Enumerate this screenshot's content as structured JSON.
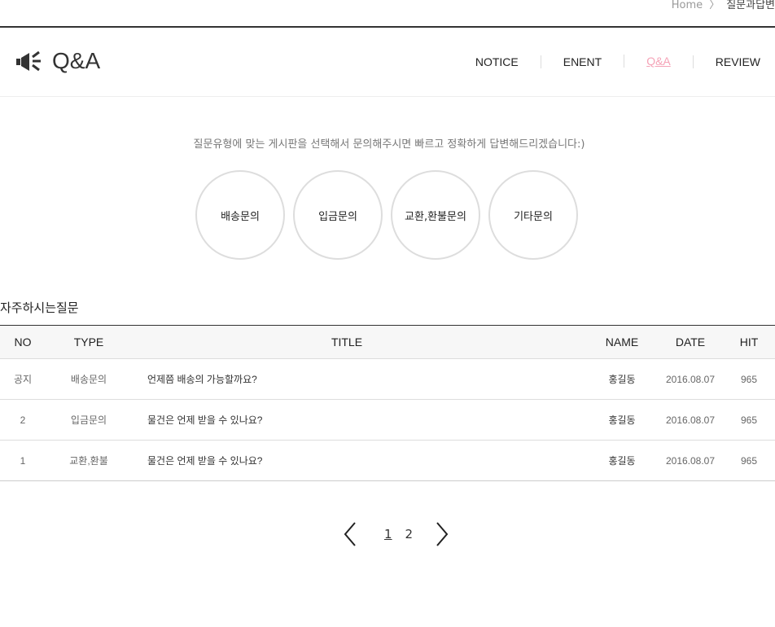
{
  "breadcrumb": {
    "home": "Home",
    "current": "질문과답변"
  },
  "header": {
    "title": "Q&A",
    "icon": "megaphone-icon"
  },
  "nav": [
    {
      "label": "NOTICE"
    },
    {
      "label": "ENENT"
    },
    {
      "label": "Q&A",
      "active": true
    },
    {
      "label": "REVIEW"
    }
  ],
  "intro": "질문유형에 맞는 게시판을 선택해서 문의해주시면 빠르고 정확하게 답변해드리겠습니다:)",
  "categories": [
    "배송문의",
    "입금문의",
    "교환,환불문의",
    "기타문의"
  ],
  "faq_title": "자주하시는질문",
  "table": {
    "headers": [
      "NO",
      "TYPE",
      "TITLE",
      "NAME",
      "DATE",
      "HIT"
    ],
    "rows": [
      {
        "no": "공지",
        "type": "배송문의",
        "title": "언제쯤 배송의 가능할까요?",
        "name": "홍길동",
        "date": "2016.08.07",
        "hit": "965"
      },
      {
        "no": "2",
        "type": "입금문의",
        "title": "물건은 언제 받을 수 있나요?",
        "name": "홍길동",
        "date": "2016.08.07",
        "hit": "965"
      },
      {
        "no": "1",
        "type": "교환,환불",
        "title": "물건은 언제 받을 수 있나요?",
        "name": "홍길동",
        "date": "2016.08.07",
        "hit": "965"
      }
    ]
  },
  "pagination": {
    "pages": [
      "1",
      "2"
    ],
    "current": "1"
  },
  "colors": {
    "accent": "#f5a3b7"
  }
}
